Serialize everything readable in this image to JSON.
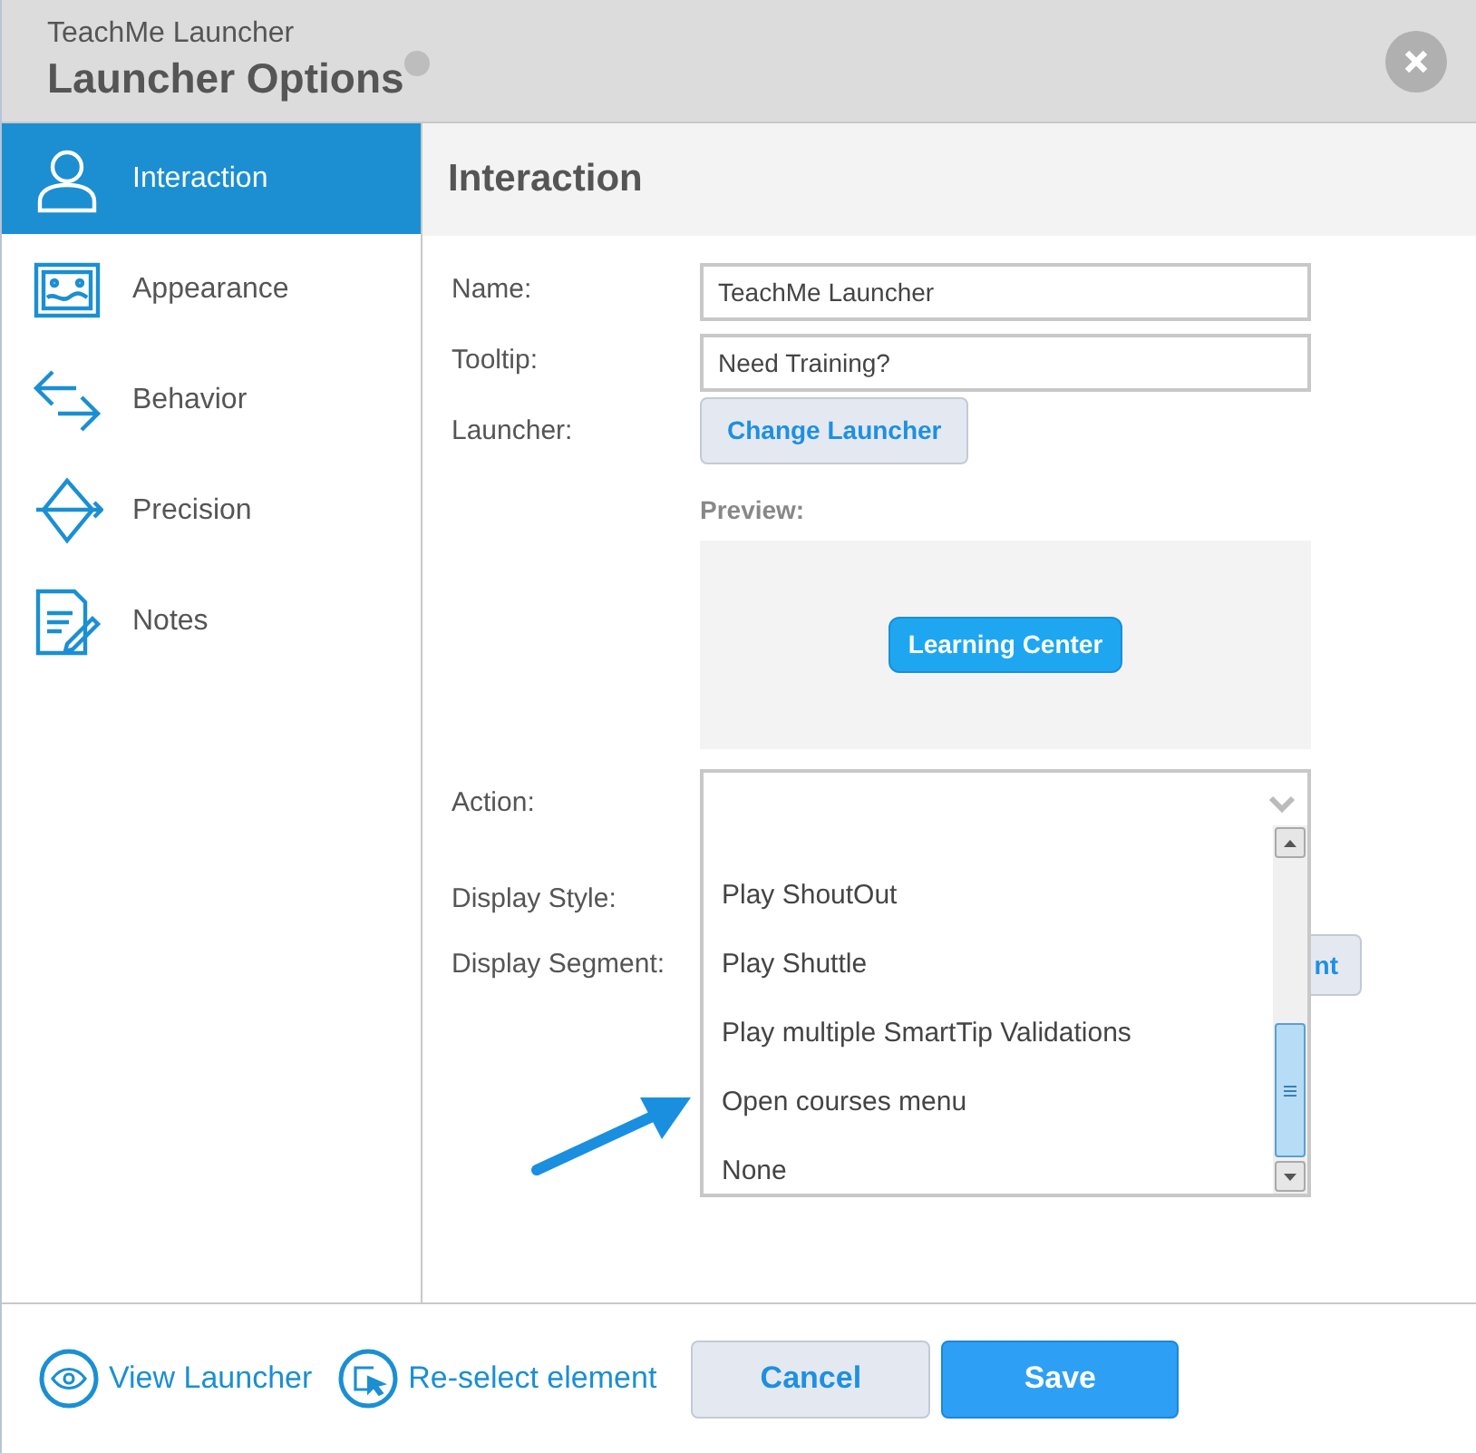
{
  "window": {
    "subtitle": "TeachMe Launcher",
    "title": "Launcher Options"
  },
  "sidebar": {
    "items": [
      {
        "label": "Interaction",
        "kind": "person",
        "selected": true
      },
      {
        "label": "Appearance",
        "kind": "picture",
        "selected": false
      },
      {
        "label": "Behavior",
        "kind": "arrows",
        "selected": false
      },
      {
        "label": "Precision",
        "kind": "bow",
        "selected": false
      },
      {
        "label": "Notes",
        "kind": "notes",
        "selected": false
      }
    ]
  },
  "panel": {
    "heading": "Interaction",
    "fields": [
      {
        "label": "Name:",
        "value": "TeachMe Launcher"
      },
      {
        "label": "Tooltip:",
        "value": "Need Training?"
      }
    ],
    "launcher": {
      "label": "Launcher:",
      "button": "Change Launcher"
    },
    "preview": {
      "label": "Preview:",
      "button": "Learning Center"
    },
    "action": {
      "label": "Action:",
      "expanded": true,
      "options": [
        {
          "label": "Play ShoutOut",
          "selected": false
        },
        {
          "label": "Play Shuttle",
          "selected": false
        },
        {
          "label": "Play multiple SmartTip Validations",
          "selected": false
        },
        {
          "label": "Open courses menu",
          "selected": false
        },
        {
          "label": "None",
          "selected": false
        }
      ]
    },
    "display_style": {
      "label": "Display Style:"
    },
    "display_segment": {
      "label": "Display Segment:",
      "button": "nt"
    }
  },
  "footer": {
    "links": [
      {
        "label": "View Launcher",
        "kind": "eye"
      },
      {
        "label": "Re-select element",
        "kind": "cursor"
      }
    ],
    "cancel": "Cancel",
    "save": "Save"
  }
}
